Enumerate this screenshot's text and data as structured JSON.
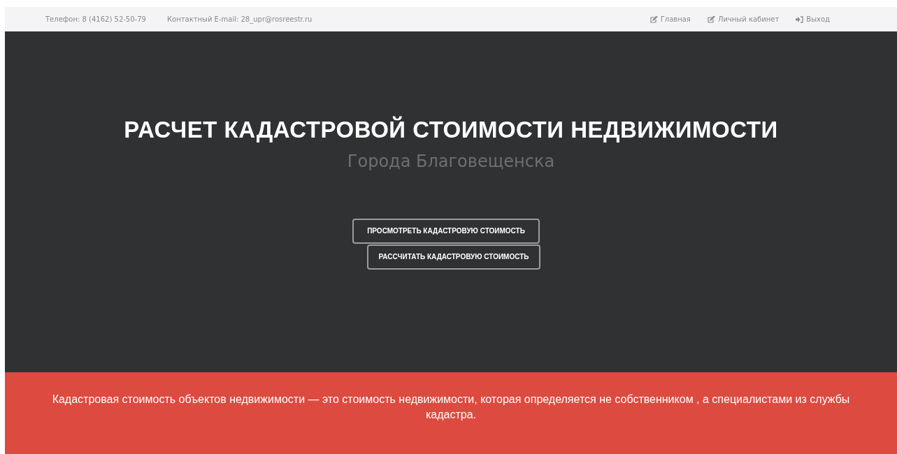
{
  "top_bar": {
    "contacts": [
      "Телефон: 8 (4162) 52-50-79",
      "Контактный E-mail: 28_upr@rosreestr.ru"
    ],
    "nav": [
      {
        "kind": "edit",
        "label": "Главная"
      },
      {
        "kind": "edit",
        "label": "Личный кабинет"
      },
      {
        "kind": "exit",
        "label": "Выход"
      }
    ]
  },
  "hero": {
    "title": "РАСЧЕТ КАДАСТРОВОЙ СТОИМОСТИ НЕДВИЖИМОСТИ",
    "subtitle": "Города Благовещенска",
    "buttons": [
      "ПРОСМОТРЕТЬ КАДАСТРОВУЮ СТОИМОСТЬ",
      "РАССЧИТАТЬ КАДАСТРОВУЮ СТОИМОСТЬ"
    ]
  },
  "banner": {
    "text": "Кадастровая стоимость объектов недвижимости — это стоимость недвижимости, которая определяется не собственником , а специалистами из службы кадастра."
  }
}
